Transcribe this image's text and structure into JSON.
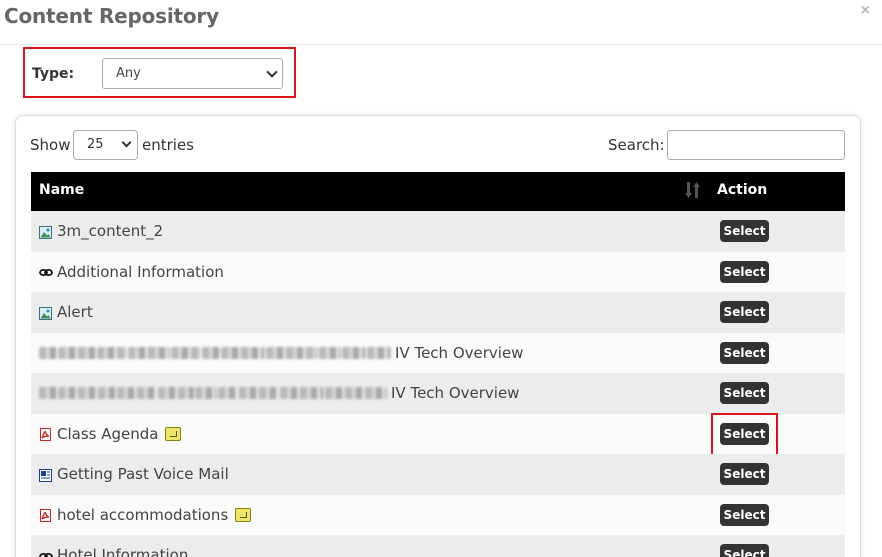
{
  "dialog": {
    "title": "Content Repository",
    "close_label": "×"
  },
  "filter": {
    "type_label": "Type:",
    "type_value": "Any"
  },
  "table_controls": {
    "show_label": "Show",
    "entries_value": "25",
    "entries_label": "entries",
    "search_label": "Search:",
    "search_value": ""
  },
  "table": {
    "columns": [
      "Name",
      "Action"
    ],
    "rows": [
      {
        "name": "3m_content_2",
        "icon": "image-icon",
        "note": false,
        "redacted": false,
        "action": "Select"
      },
      {
        "name": "Additional Information",
        "icon": "link-icon",
        "note": false,
        "redacted": false,
        "action": "Select"
      },
      {
        "name": "Alert",
        "icon": "image-icon",
        "note": false,
        "redacted": false,
        "action": "Select"
      },
      {
        "name": "IV Tech Overview",
        "icon": "none",
        "note": false,
        "redacted": true,
        "action": "Select"
      },
      {
        "name": "IV Tech Overview",
        "icon": "none",
        "note": false,
        "redacted": true,
        "action": "Select"
      },
      {
        "name": "Class Agenda",
        "icon": "pdf-icon",
        "note": true,
        "redacted": false,
        "action": "Select",
        "highlighted": true
      },
      {
        "name": "Getting Past Voice Mail",
        "icon": "document-icon",
        "note": false,
        "redacted": false,
        "action": "Select"
      },
      {
        "name": "hotel accommodations",
        "icon": "pdf-icon",
        "note": true,
        "redacted": false,
        "action": "Select"
      },
      {
        "name": "Hotel Information",
        "icon": "link-icon",
        "note": false,
        "redacted": false,
        "action": "Select"
      }
    ]
  },
  "colors": {
    "highlight": "#d9141b",
    "header_bg": "#000000",
    "button_bg": "#333333"
  }
}
